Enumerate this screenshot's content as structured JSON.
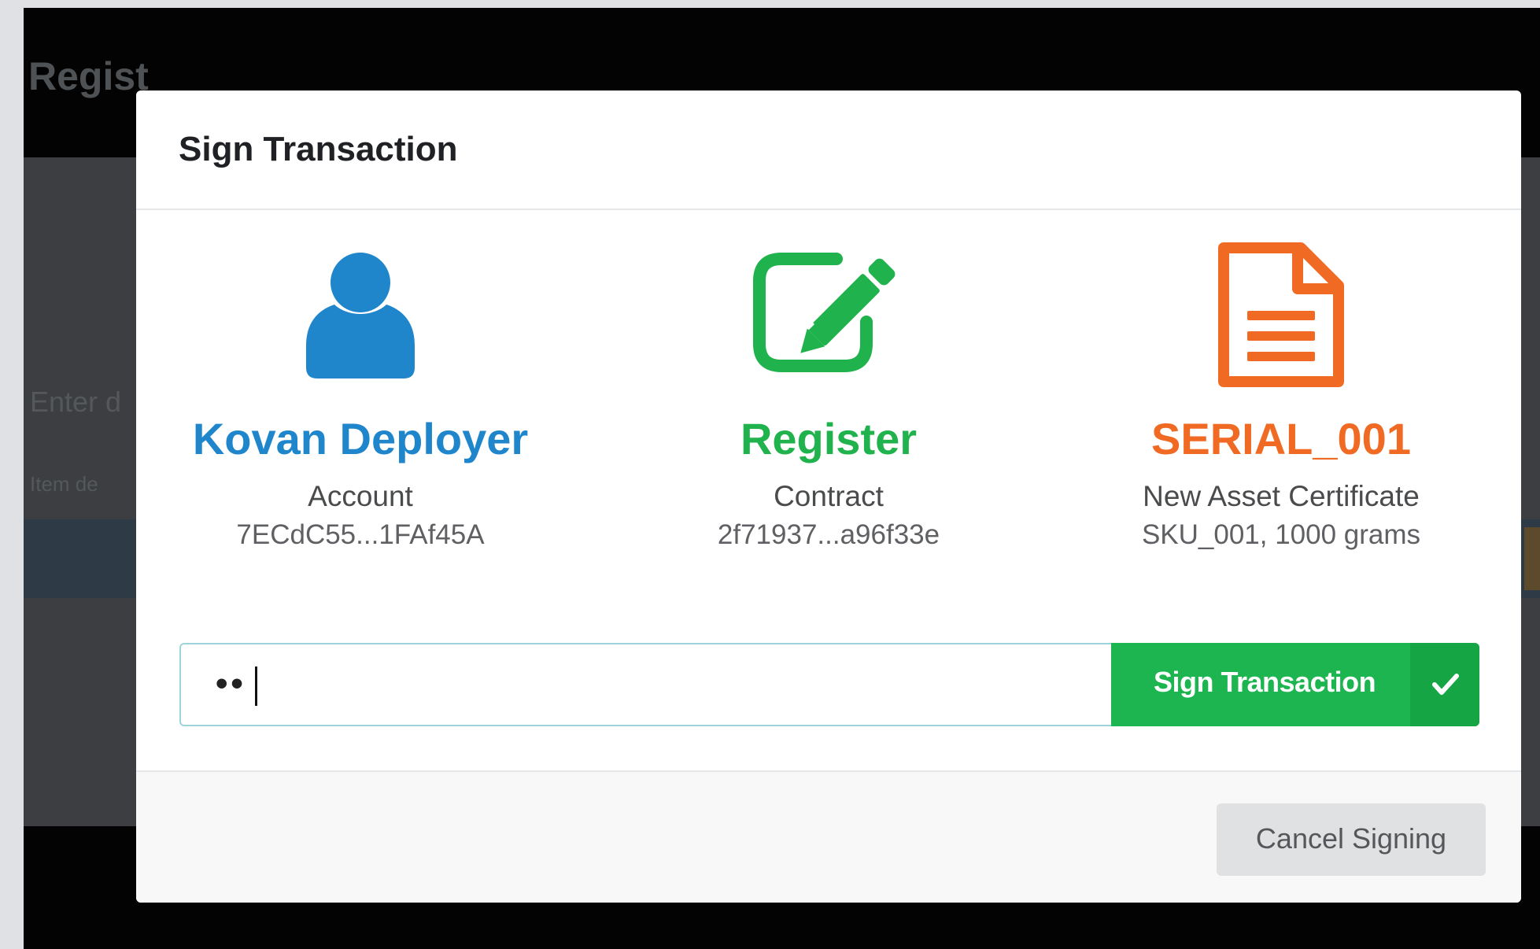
{
  "background": {
    "title": "Regist",
    "text_a": "Enter d",
    "text_b": "Item de"
  },
  "modal": {
    "title": "Sign Transaction"
  },
  "parties": [
    {
      "name": "Kovan Deployer",
      "type": "Account",
      "detail": "7ECdC55...1FAf45A",
      "color": "#1f86cc",
      "icon": "user-icon"
    },
    {
      "name": "Register",
      "type": "Contract",
      "detail": "2f71937...a96f33e",
      "color": "#20b24c",
      "icon": "edit-icon"
    },
    {
      "name": "SERIAL_001",
      "type": "New Asset Certificate",
      "detail": "SKU_001, 1000 grams",
      "color": "#f06a24",
      "icon": "document-icon"
    }
  ],
  "signing": {
    "password_value": "••",
    "button_label": "Sign Transaction",
    "button_color": "#1db550",
    "check_icon": "check-icon"
  },
  "footer": {
    "cancel_label": "Cancel Signing"
  }
}
